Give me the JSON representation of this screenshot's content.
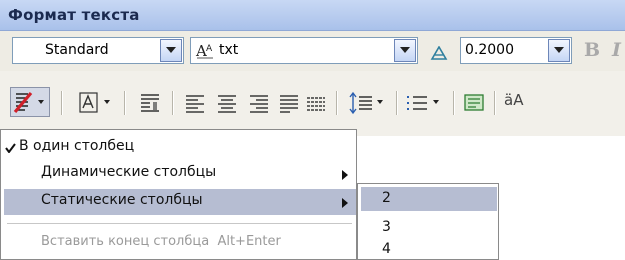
{
  "panel": {
    "title": "Формат текста"
  },
  "toolbar_row1": {
    "style_value": "Standard",
    "font_value": "txt",
    "height_value": "0.2000",
    "bold_label": "B",
    "italic_label": "I"
  },
  "toolbar_row2": {
    "case_label": "äA"
  },
  "menu": {
    "items": [
      {
        "label": "В один столбец",
        "checked": true
      },
      {
        "label": "Динамические столбцы",
        "submenu": true
      },
      {
        "label": "Статические столбцы",
        "submenu": true,
        "highlighted": true
      },
      {
        "label": "Вставить конец столбца  Alt+Enter",
        "disabled": true
      }
    ]
  },
  "submenu": {
    "items": [
      "2",
      "3",
      "4"
    ],
    "highlighted": "2"
  },
  "colors": {
    "title_bar": "#a9c1ea",
    "highlight": "#b6bdd2",
    "disabled_text": "#9a9a9a"
  }
}
